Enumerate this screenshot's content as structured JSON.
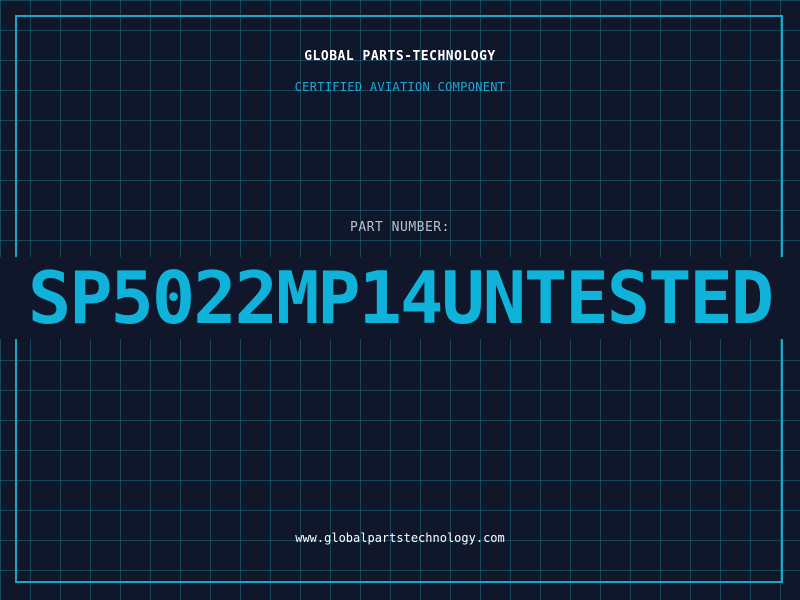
{
  "header": {
    "company": "GLOBAL PARTS-TECHNOLOGY",
    "subtitle": "CERTIFIED AVIATION COMPONENT"
  },
  "part": {
    "label": "PART NUMBER:",
    "number": "SP5022MP14UNTESTED"
  },
  "footer": {
    "website": "www.globalpartstechnology.com"
  },
  "colors": {
    "background": "#10172b",
    "grid": "#1e6e82",
    "accent": "#0fb3da",
    "frame": "#1aa6c9",
    "text": "#ffffff"
  }
}
